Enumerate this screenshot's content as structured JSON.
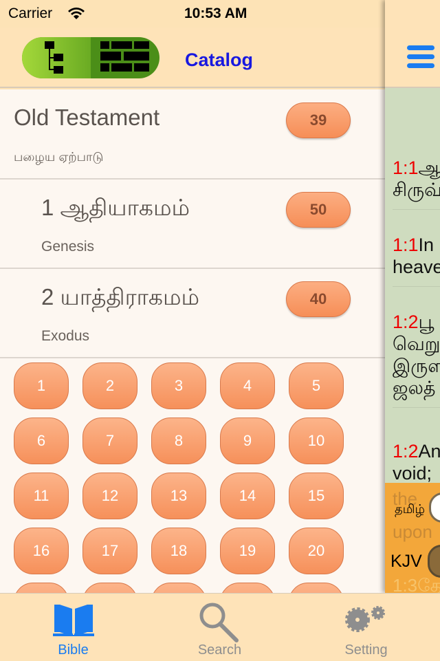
{
  "status_bar": {
    "carrier": "Carrier",
    "time": "10:53 AM"
  },
  "navbar": {
    "title": "Catalog"
  },
  "section": {
    "title": "Old Testament",
    "subtitle": "பழைய ஏற்பாடு",
    "count": "39"
  },
  "books": [
    {
      "title": "1 ஆதியாகமம்",
      "subtitle": "Genesis",
      "count": "50"
    },
    {
      "title": "2 யாத்திராகமம்",
      "subtitle": "Exodus",
      "count": "40"
    }
  ],
  "chapters": [
    "1",
    "2",
    "3",
    "4",
    "5",
    "6",
    "7",
    "8",
    "9",
    "10",
    "11",
    "12",
    "13",
    "14",
    "15",
    "16",
    "17",
    "18",
    "19",
    "20"
  ],
  "reader": {
    "verses": [
      {
        "ref": "1:1",
        "lines": [
          "ஆ",
          "சிருவ்"
        ]
      },
      {
        "ref": "1:1",
        "lines": [
          "In",
          "heave"
        ]
      },
      {
        "ref": "1:2",
        "lines": [
          "பூ",
          "வெறு",
          "இருள",
          "ஜலத்"
        ]
      },
      {
        "ref": "1:2",
        "lines": [
          "An",
          "void;"
        ]
      }
    ],
    "faded": [
      "the",
      "upon",
      "1:3தே"
    ],
    "toggles": {
      "tamil": "தமிழ்",
      "kjv": "KJV"
    }
  },
  "tabs": [
    {
      "label": "Bible",
      "icon": "book-icon",
      "active": true
    },
    {
      "label": "Search",
      "icon": "magnifier-icon"
    },
    {
      "label": "Setting",
      "icon": "gears-icon"
    }
  ],
  "colors": {
    "accent": "#1a7cf0",
    "badge": "#f6905a",
    "verse_ref": "#e00000"
  }
}
